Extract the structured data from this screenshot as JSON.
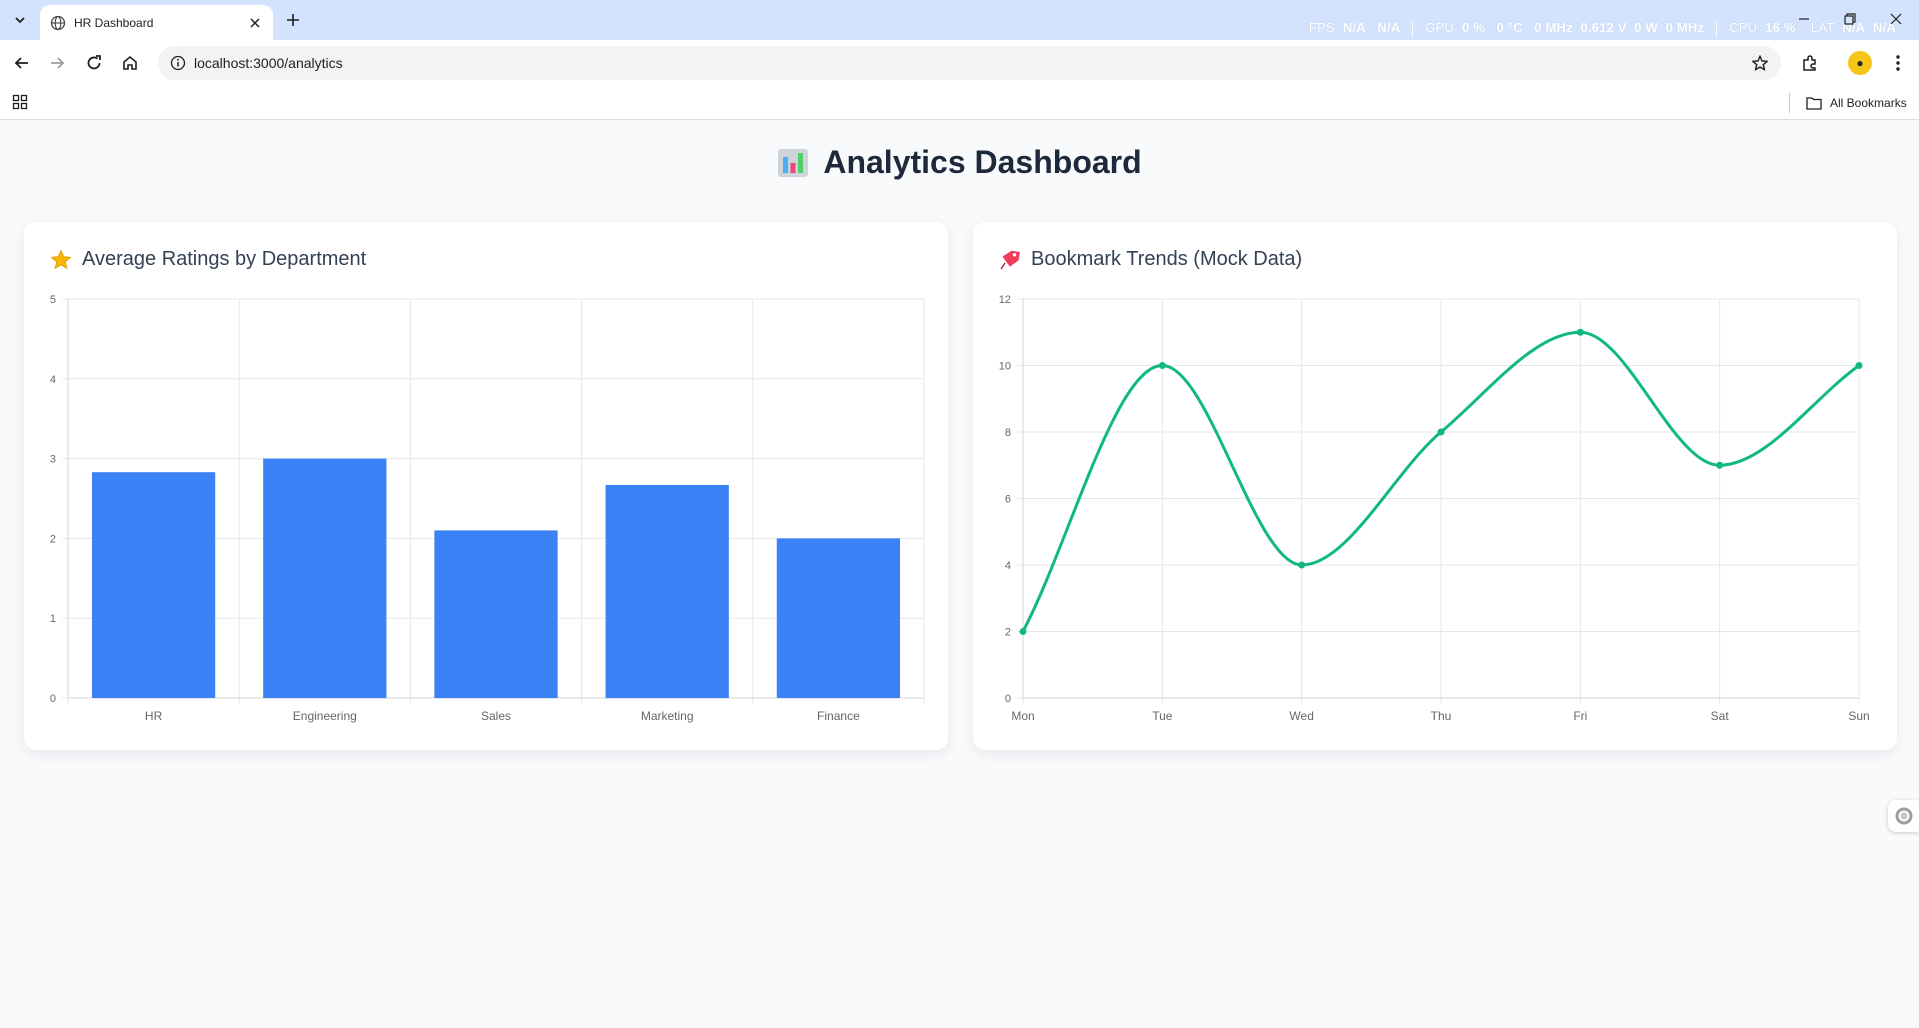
{
  "browser": {
    "tab_title": "HR Dashboard",
    "url": "localhost:3000/analytics",
    "bookmarks_label": "All Bookmarks",
    "overlay": {
      "fps_label": "FPS",
      "fps_a": "N/A",
      "fps_b": "N/A",
      "gpu_label": "GPU",
      "gpu_pct": "0 %",
      "gpu_temp": "0 °C",
      "gpu_clock": "0 MHz",
      "gpu_volt": "0.612 V",
      "gpu_power": "0 W",
      "gpu_mem": "0 MHz",
      "cpu_label": "CPU",
      "cpu_pct": "16 %",
      "lat_label": "LAT",
      "lat_a": "N/A",
      "lat_b": "N/A"
    }
  },
  "page": {
    "title": "Analytics Dashboard"
  },
  "colors": {
    "bar": "#3b82f6",
    "line": "#10b981",
    "grid": "#e5e7eb",
    "tick": "#666666"
  },
  "charts": {
    "ratings": {
      "title": "Average Ratings by Department"
    },
    "bookmarks": {
      "title": "Bookmark Trends (Mock Data)"
    }
  },
  "chart_data": [
    {
      "type": "bar",
      "title": "Average Ratings by Department",
      "categories": [
        "HR",
        "Engineering",
        "Sales",
        "Marketing",
        "Finance"
      ],
      "values": [
        2.83,
        3.0,
        2.1,
        2.67,
        2.0
      ],
      "xlabel": "",
      "ylabel": "",
      "ylim": [
        0,
        5
      ],
      "yticks": [
        0,
        1,
        2,
        3,
        4,
        5
      ],
      "grid": true
    },
    {
      "type": "line",
      "title": "Bookmark Trends (Mock Data)",
      "categories": [
        "Mon",
        "Tue",
        "Wed",
        "Thu",
        "Fri",
        "Sat",
        "Sun"
      ],
      "values": [
        2,
        10,
        4,
        8,
        11,
        7,
        10
      ],
      "xlabel": "",
      "ylabel": "",
      "ylim": [
        0,
        12
      ],
      "yticks": [
        0,
        2,
        4,
        6,
        8,
        10,
        12
      ],
      "grid": true,
      "smooth": true
    }
  ]
}
